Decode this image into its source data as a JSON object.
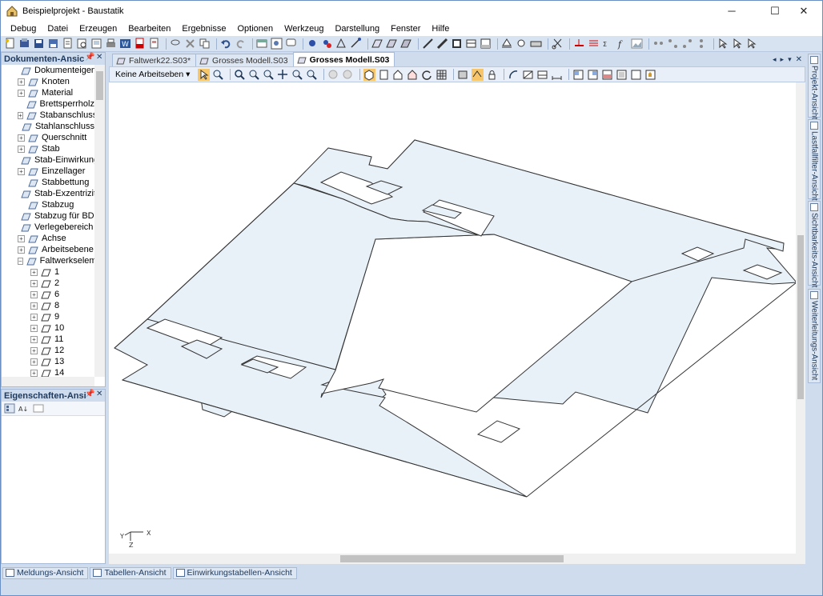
{
  "window": {
    "title": "Beispielprojekt - Baustatik"
  },
  "menu": [
    "Debug",
    "Datei",
    "Erzeugen",
    "Bearbeiten",
    "Ergebnisse",
    "Optionen",
    "Werkzeug",
    "Darstellung",
    "Fenster",
    "Hilfe"
  ],
  "doc_panel": {
    "title": "Dokumenten-Ansic",
    "items": [
      {
        "label": "Dokumenteigen",
        "icon": "document-properties-icon",
        "expandable": false
      },
      {
        "label": "Knoten",
        "icon": "node-icon",
        "expandable": true
      },
      {
        "label": "Material",
        "icon": "material-icon",
        "expandable": true
      },
      {
        "label": "Brettsperrholz",
        "icon": "clt-panel-icon",
        "expandable": false
      },
      {
        "label": "Stabanschluss",
        "icon": "member-connection-icon",
        "expandable": true
      },
      {
        "label": "Stahlanschluss",
        "icon": "steel-connection-icon",
        "expandable": false
      },
      {
        "label": "Querschnitt",
        "icon": "cross-section-icon",
        "expandable": true
      },
      {
        "label": "Stab",
        "icon": "member-icon",
        "expandable": true
      },
      {
        "label": "Stab-Einwirkung",
        "icon": "member-load-icon",
        "expandable": false
      },
      {
        "label": "Einzellager",
        "icon": "single-support-icon",
        "expandable": true
      },
      {
        "label": "Stabbettung",
        "icon": "member-bedding-icon",
        "expandable": false
      },
      {
        "label": "Stab-Exzentrizitä",
        "icon": "member-eccentricity-icon",
        "expandable": false
      },
      {
        "label": "Stabzug",
        "icon": "member-chain-icon",
        "expandable": false
      },
      {
        "label": "Stabzug für BDK",
        "icon": "member-chain-bdk-icon",
        "expandable": false
      },
      {
        "label": "Verlegebereich fi",
        "icon": "laying-area-icon",
        "expandable": false
      },
      {
        "label": "Achse",
        "icon": "axis-icon",
        "expandable": true
      },
      {
        "label": "Arbeitsebene",
        "icon": "work-plane-icon",
        "expandable": true
      },
      {
        "label": "Faltwerkselemer",
        "icon": "folded-plate-icon",
        "expandable": true,
        "expanded": true
      }
    ],
    "children": [
      "1",
      "2",
      "6",
      "8",
      "9",
      "10",
      "11",
      "12",
      "13",
      "14"
    ]
  },
  "props_panel": {
    "title": "Eigenschaften-Ansi"
  },
  "tabs": [
    {
      "label": "Faltwerk22.S03*",
      "active": false
    },
    {
      "label": "Grosses Modell.S03",
      "active": false
    },
    {
      "label": "Grosses Modell.S03",
      "active": true
    }
  ],
  "viewbar": {
    "workplane_dropdown": "Keine Arbeitseben"
  },
  "side_tabs": [
    "Projekt-Ansicht",
    "Lastfallfilter-Ansicht",
    "Sichtbarkeits-Ansicht",
    "Weiterleitungs-Ansicht"
  ],
  "bottom_tabs": [
    "Meldungs-Ansicht",
    "Tabellen-Ansicht",
    "Einwirkungstabellen-Ansicht"
  ],
  "axes": {
    "x": "X",
    "y": "Y",
    "z": "Z"
  },
  "colors": {
    "accent": "#cfdcee",
    "model_fill": "#e8f0f8",
    "model_stroke": "#333333",
    "toolbar_active": "#f7c66b"
  }
}
